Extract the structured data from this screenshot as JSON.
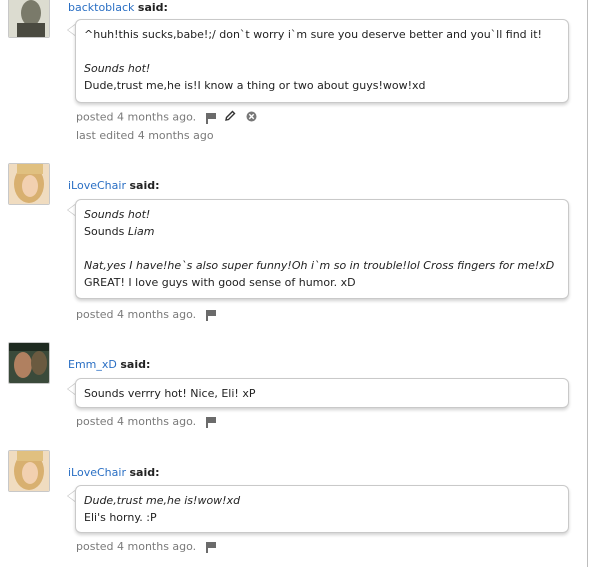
{
  "comments": [
    {
      "author": "backtoblack",
      "said": "said:",
      "lines": [
        {
          "text": "^huh!this sucks,babe!;/ don`t worry i`m sure you deserve better and you`ll find it!",
          "italic": false
        },
        {
          "text": "",
          "italic": false
        },
        {
          "text": "Sounds hot!",
          "italic": true
        },
        {
          "text": "Dude,trust me,he is!I know a thing or two about guys!wow!xd",
          "italic": false
        }
      ],
      "posted": "posted 4 months ago.",
      "edited": "last edited 4 months ago",
      "icons": [
        "flag-icon",
        "pencil-icon",
        "delete-icon"
      ]
    },
    {
      "author": "iLoveChair",
      "said": "said:",
      "lines": [
        {
          "text": "Sounds hot!",
          "italic": true
        },
        {
          "text_plain": "Sounds ",
          "text_em": "Liam"
        },
        {
          "text": "",
          "italic": false
        },
        {
          "text": "Nat,yes I have!he`s also super funny!Oh i`m so in trouble!lol Cross fingers for me!xD",
          "italic": true
        },
        {
          "text": "GREAT! I love guys with good sense of humor. xD",
          "italic": false
        }
      ],
      "posted": "posted 4 months ago.",
      "icons": [
        "flag-icon"
      ]
    },
    {
      "author": "Emm_xD",
      "said": "said:",
      "lines": [
        {
          "text": "Sounds verrry hot! Nice, Eli! xP",
          "italic": false
        }
      ],
      "posted": "posted 4 months ago.",
      "icons": [
        "flag-icon"
      ]
    },
    {
      "author": "iLoveChair",
      "said": "said:",
      "lines": [
        {
          "text": "Dude,trust me,he is!wow!xd",
          "italic": true
        },
        {
          "text": "Eli's horny. :P",
          "italic": false
        }
      ],
      "posted": "posted 4 months ago.",
      "icons": [
        "flag-icon"
      ]
    }
  ]
}
